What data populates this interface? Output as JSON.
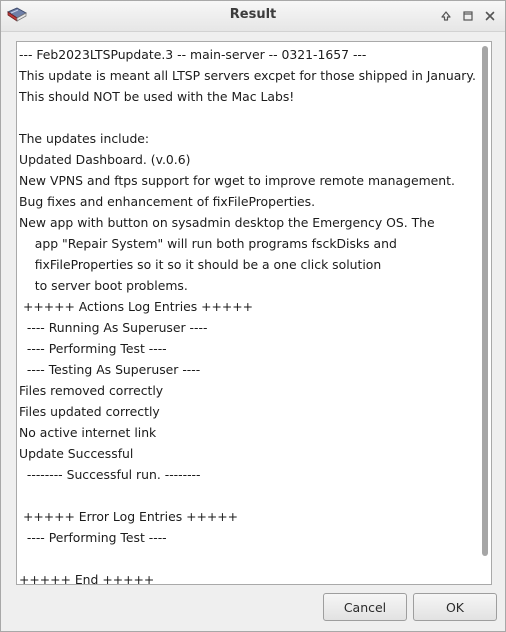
{
  "window": {
    "title": "Result",
    "app_icon": "book-icon",
    "controls": [
      "shade-icon",
      "maximize-icon",
      "close-icon"
    ]
  },
  "content": {
    "lines": [
      "--- Feb2023LTSPupdate.3 -- main-server -- 0321-1657 ---",
      "This update is meant all LTSP servers excpet for those shipped in January.",
      "This should NOT be used with the Mac Labs!",
      "",
      "The updates include:",
      "Updated Dashboard. (v.0.6)",
      "New VPNS and ftps support for wget to improve remote management.",
      "Bug fixes and enhancement of fixFileProperties.",
      "New app with button on sysadmin desktop the Emergency OS. The",
      "    app \"Repair System\" will run both programs fsckDisks and",
      "    fixFileProperties so it so it should be a one click solution",
      "    to server boot problems.",
      " +++++ Actions Log Entries +++++",
      "  ---- Running As Superuser ----",
      "  ---- Performing Test ----",
      "  ---- Testing As Superuser ----",
      "Files removed correctly",
      "Files updated correctly",
      "No active internet link",
      "Update Successful",
      "  -------- Successful run. --------",
      "",
      " +++++ Error Log Entries +++++",
      "  ---- Performing Test ----",
      "",
      "+++++ End +++++"
    ]
  },
  "buttons": {
    "cancel": "Cancel",
    "ok": "OK"
  }
}
